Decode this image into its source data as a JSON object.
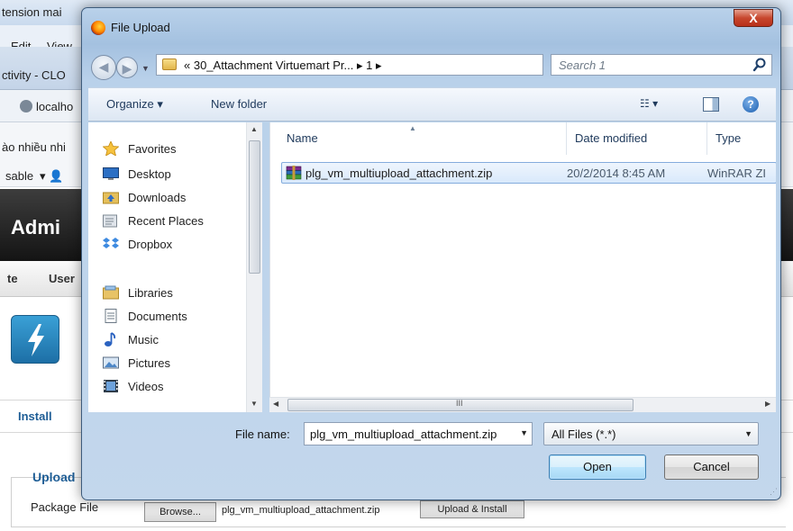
{
  "background": {
    "title_fragment": "tension mai",
    "menu": [
      "Edit",
      "View"
    ],
    "tab_fragment": "ctivity - CLO",
    "url_fragment": "localho",
    "bookmark_fragment": "ào nhiều nhi",
    "dropdown_fragment": "sable",
    "admin_title": "Admi",
    "nav_items": [
      "te",
      "User"
    ],
    "install_link": "Install",
    "upload_legend": "Upload",
    "package_label": "Package File",
    "browse_label": "Browse...",
    "selected_file": "plg_vm_multiupload_attachment.zip",
    "upload_install_label": "Upload & Install"
  },
  "dialog": {
    "title": "File Upload",
    "close_label": "X",
    "address": {
      "path": "« 30_Attachment Virtuemart Pr... ▸ 1 ▸",
      "search_placeholder": "Search 1"
    },
    "toolbar": {
      "organize": "Organize ▾",
      "new_folder": "New folder",
      "views": "☷ ▾",
      "help": "?"
    },
    "nav": {
      "favorites_header": "Favorites",
      "favorites": [
        "Desktop",
        "Downloads",
        "Recent Places",
        "Dropbox"
      ],
      "libraries_header": "Libraries",
      "libraries": [
        "Documents",
        "Music",
        "Pictures",
        "Videos"
      ]
    },
    "columns": [
      "Name",
      "Date modified",
      "Type"
    ],
    "files": [
      {
        "name": "plg_vm_multiupload_attachment.zip",
        "date_modified": "20/2/2014 8:45 AM",
        "type": "WinRAR ZI"
      }
    ],
    "file_name_label": "File name:",
    "file_name_value": "plg_vm_multiupload_attachment.zip",
    "file_type": "All Files (*.*)",
    "open_label": "Open",
    "cancel_label": "Cancel",
    "scroll_grip": "III"
  }
}
